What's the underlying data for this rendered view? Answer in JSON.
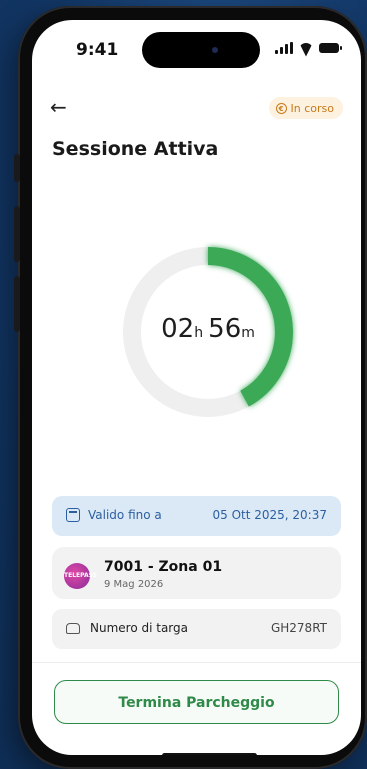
{
  "status_bar": {
    "time": "9:41"
  },
  "header": {
    "badge_label": "In corso"
  },
  "page": {
    "title": "Sessione Attiva"
  },
  "timer": {
    "hours": "02",
    "hours_unit": "h",
    "minutes": "56",
    "minutes_unit": "m",
    "progress_fraction": 0.42,
    "ring_color": "#3aa957",
    "track_color": "#efefef"
  },
  "validity": {
    "label": "Valido fino a",
    "value": "05 Ott 2025, 20:37"
  },
  "zone": {
    "logo_text": "TELEPASS",
    "name": "7001 - Zona 01",
    "date": "9 Mag 2026"
  },
  "plate": {
    "label": "Numero di targa",
    "value": "GH278RT"
  },
  "actions": {
    "end_label": "Termina Parcheggio"
  },
  "colors": {
    "accent": "#2f8a49",
    "badge": "#c77a1a",
    "info": "#2c5fa0"
  }
}
